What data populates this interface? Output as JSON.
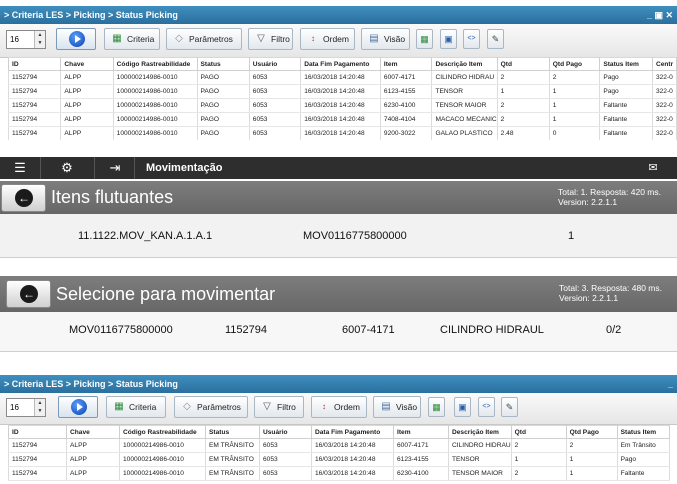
{
  "top_window": {
    "breadcrumb": "> Criteria LES > Picking > Status Picking",
    "window_controls": "_ ▣ ✕",
    "spin_value": "16",
    "buttons": {
      "criteria": "Criteria",
      "parametros": "Parâmetros",
      "filtro": "Filtro",
      "ordem": "Ordem",
      "visao": "Visão"
    },
    "columns": [
      "ID",
      "Chave",
      "Código Rastreabilidade",
      "Status",
      "Usuário",
      "Data Fim Pagamento",
      "Item",
      "Descrição Item",
      "Qtd",
      "Qtd Pago",
      "Status Item",
      "Centr"
    ],
    "rows": [
      [
        "1152794",
        "ALPP",
        "100000214986-0010",
        "PAGO",
        "6053",
        "16/03/2018 14:20:48",
        "6007-4171",
        "CILINDRO HIDRAU",
        "2",
        "2",
        "Pago",
        "322-0"
      ],
      [
        "1152794",
        "ALPP",
        "100000214986-0010",
        "PAGO",
        "6053",
        "16/03/2018 14:20:48",
        "6123-4155",
        "TENSOR",
        "1",
        "1",
        "Pago",
        "322-0"
      ],
      [
        "1152794",
        "ALPP",
        "100000214986-0010",
        "PAGO",
        "6053",
        "16/03/2018 14:20:48",
        "6230-4100",
        "TENSOR MAIOR",
        "2",
        "1",
        "Faltante",
        "322-0"
      ],
      [
        "1152794",
        "ALPP",
        "100000214986-0010",
        "PAGO",
        "6053",
        "16/03/2018 14:20:48",
        "7408-4104",
        "MACACO MECANIC",
        "2",
        "1",
        "Faltante",
        "322-0"
      ],
      [
        "1152794",
        "ALPP",
        "100000214986-0010",
        "PAGO",
        "6053",
        "16/03/2018 14:20:48",
        "9200-3022",
        "GALAO PLASTICO",
        "2.48",
        "0",
        "Faltante",
        "322-0"
      ]
    ]
  },
  "movimentacao": {
    "title": "Movimentação",
    "itens": {
      "title": "Itens flutuantes",
      "total": "Total: 1. Resposta: 420 ms.",
      "version": "Version: 2.2.1.1",
      "row": {
        "location": "11.1122.MOV_KAN.A.1.A.1",
        "code": "MOV0116775800000",
        "qty": "1"
      }
    },
    "selecione": {
      "title": "Selecione para movimentar",
      "total": "Total: 3. Resposta: 480 ms.",
      "version": "Version: 2.2.1.1",
      "row": {
        "code": "MOV0116775800000",
        "id": "1152794",
        "item": "6007-4171",
        "desc": "CILINDRO HIDRAUL",
        "qty": "0/2"
      }
    }
  },
  "bottom_window": {
    "breadcrumb": "> Criteria LES > Picking > Status Picking",
    "window_controls": "_",
    "spin_value": "16",
    "buttons": {
      "criteria": "Criteria",
      "parametros": "Parâmetros",
      "filtro": "Filtro",
      "ordem": "Ordem",
      "visao": "Visão"
    },
    "columns": [
      "ID",
      "Chave",
      "Código Rastreabilidade",
      "Status",
      "Usuário",
      "Data Fim Pagamento",
      "Item",
      "Descrição Item",
      "Qtd",
      "Qtd Pago",
      "Status Item"
    ],
    "rows": [
      [
        "1152794",
        "ALPP",
        "100000214986-0010",
        "EM TRÂNSITO",
        "6053",
        "16/03/2018 14:20:48",
        "6007-4171",
        "CILINDRO HIDRAU",
        "2",
        "2",
        "Em Trânsito"
      ],
      [
        "1152794",
        "ALPP",
        "100000214986-0010",
        "EM TRÂNSITO",
        "6053",
        "16/03/2018 14:20:48",
        "6123-4155",
        "TENSOR",
        "1",
        "1",
        "Pago"
      ],
      [
        "1152794",
        "ALPP",
        "100000214986-0010",
        "EM TRÂNSITO",
        "6053",
        "16/03/2018 14:20:48",
        "6230-4100",
        "TENSOR MAIOR",
        "2",
        "1",
        "Faltante"
      ]
    ]
  }
}
